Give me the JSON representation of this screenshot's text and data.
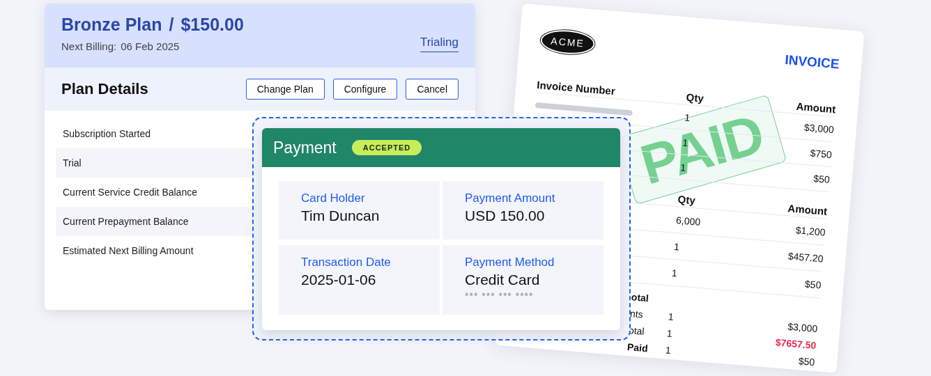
{
  "plan": {
    "title": "Bronze Plan",
    "separator": "/",
    "price": "$150.00",
    "next_billing_label": "Next Billing:",
    "next_billing_date": "06 Feb 2025",
    "status": "Trialing"
  },
  "plan_details": {
    "heading": "Plan Details",
    "buttons": [
      "Change Plan",
      "Configure",
      "Cancel"
    ],
    "rows": [
      "Subscription Started",
      "Trial",
      "Current Service Credit Balance",
      "Current Prepayment Balance",
      "Estimated Next Billing Amount"
    ]
  },
  "payment": {
    "title": "Payment",
    "badge": "ACCEPTED",
    "fields": [
      {
        "label": "Card Holder",
        "value": "Tim Duncan"
      },
      {
        "label": "Payment Amount",
        "value": "USD 150.00"
      },
      {
        "label": "Transaction Date",
        "value": "2025-01-06"
      },
      {
        "label": "Payment Method",
        "value": "Credit Card",
        "masked": "*** *** *** ****"
      }
    ]
  },
  "invoice": {
    "logo": "ACME",
    "title": "INVOICE",
    "stamp": "PAID",
    "table_1": {
      "columns": [
        "Invoice Number",
        "Qty",
        "Amount"
      ],
      "rows": [
        {
          "qty": "1",
          "amount": "$3,000"
        },
        {
          "qty": "1",
          "amount": "$750"
        },
        {
          "qty": "1",
          "amount": "$50"
        }
      ]
    },
    "table_2": {
      "columns": [
        "Qty",
        "Amount"
      ],
      "rows": [
        {
          "qty": "6,000",
          "amount": "$1,200"
        },
        {
          "qty": "1",
          "amount": "$457.20"
        },
        {
          "qty": "1",
          "amount": "$50"
        }
      ]
    },
    "summary": [
      {
        "kind": "heading",
        "label": "otal"
      },
      {
        "kind": "line",
        "label": "nts",
        "qty": "1",
        "amount": "$3,000"
      },
      {
        "kind": "due",
        "label": "otal",
        "qty": "1",
        "amount": "$7657.50"
      },
      {
        "kind": "heading",
        "label": "Paid",
        "qty": "1",
        "amount": "$50"
      }
    ]
  }
}
